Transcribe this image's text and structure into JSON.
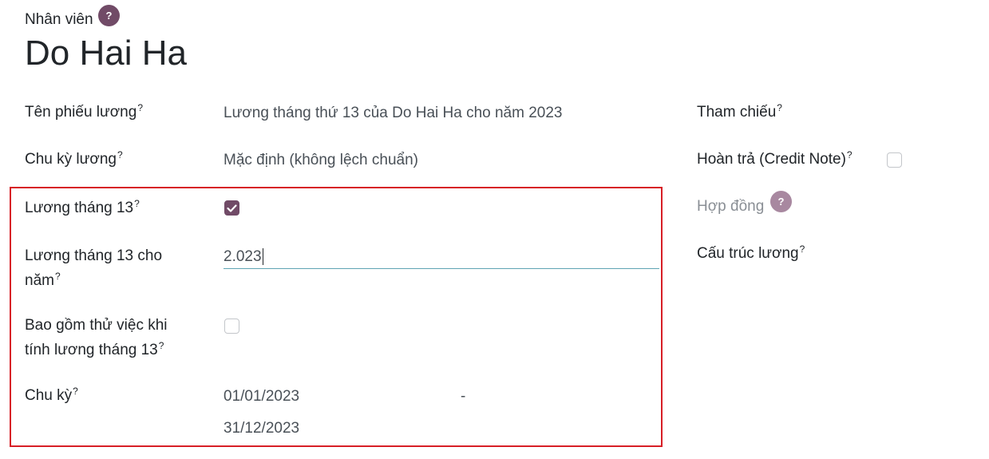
{
  "header": {
    "employee_label": "Nhân viên",
    "help_icon_text": "?",
    "employee_name": "Do Hai Ha"
  },
  "left_fields": {
    "payslip_name": {
      "label": "Tên phiếu lương",
      "help": "?",
      "value": "Lương tháng thứ 13 của Do Hai Ha cho năm 2023"
    },
    "pay_period": {
      "label": "Chu kỳ lương",
      "help": "?",
      "value": "Mặc định (không lệch chuẩn)"
    },
    "thirteenth_month": {
      "label": "Lương tháng 13",
      "help": "?",
      "checked": true
    },
    "thirteenth_year": {
      "label_line1": "Lương tháng 13 cho",
      "label_line2": "năm",
      "help": "?",
      "value": "2.023"
    },
    "include_probation": {
      "label_line1": "Bao gồm thử việc khi",
      "label_line2": "tính lương tháng 13",
      "help": "?",
      "checked": false
    },
    "period": {
      "label": "Chu kỳ",
      "help": "?",
      "date_from": "01/01/2023",
      "separator": "-",
      "date_to": "31/12/2023"
    }
  },
  "right_fields": {
    "reference": {
      "label": "Tham chiếu",
      "help": "?"
    },
    "credit_note": {
      "label": "Hoàn trả (Credit Note)",
      "help": "?",
      "checked": false
    },
    "contract": {
      "label": "Hợp đồng",
      "help_icon_text": "?"
    },
    "salary_structure": {
      "label": "Cấu trúc lương",
      "help": "?"
    }
  },
  "colors": {
    "accent": "#714b67",
    "highlight_border": "#d71f26",
    "input_underline": "#5fa4b4"
  }
}
